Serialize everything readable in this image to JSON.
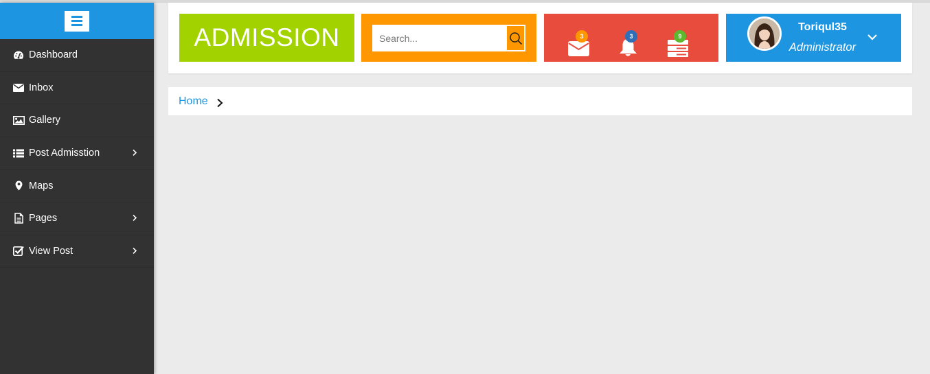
{
  "sidebar": {
    "toggle_icon": "hamburger-icon",
    "items": [
      {
        "label": "Dashboard",
        "icon": "dashboard-icon",
        "has_submenu": false
      },
      {
        "label": "Inbox",
        "icon": "envelope-icon",
        "has_submenu": false
      },
      {
        "label": "Gallery",
        "icon": "image-icon",
        "has_submenu": false
      },
      {
        "label": "Post Admisstion",
        "icon": "list-icon",
        "has_submenu": true
      },
      {
        "label": "Maps",
        "icon": "map-marker-icon",
        "has_submenu": false
      },
      {
        "label": "Pages",
        "icon": "file-icon",
        "has_submenu": true
      },
      {
        "label": "View Post",
        "icon": "check-square-icon",
        "has_submenu": true
      }
    ]
  },
  "header": {
    "brand": "ADMISSION",
    "search": {
      "placeholder": "Search...",
      "value": "",
      "icon": "search-icon"
    },
    "notifications": [
      {
        "icon": "envelope-icon",
        "count": "3",
        "badge_color": "#ff9800"
      },
      {
        "icon": "bell-icon",
        "count": "3",
        "badge_color": "#2f6fb5"
      },
      {
        "icon": "server-icon",
        "count": "9",
        "badge_color": "#5cb82d"
      }
    ],
    "user": {
      "name": "Toriqul35",
      "role": "Administrator",
      "avatar": "avatar",
      "caret_icon": "chevron-down-icon"
    }
  },
  "breadcrumb": {
    "home": "Home",
    "separator_icon": "chevron-right-icon"
  },
  "colors": {
    "brand_tile": "#a2d200",
    "search_tile": "#ff9800",
    "notify_tile": "#e84c3d",
    "user_tile": "#1e95e0",
    "sidebar_bg": "#323232",
    "page_bg": "#ebebeb"
  }
}
